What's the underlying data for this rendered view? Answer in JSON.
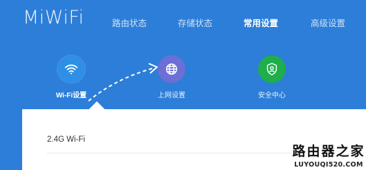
{
  "header": {
    "logo": "MiWiFi",
    "nav": [
      {
        "label": "路由状态"
      },
      {
        "label": "存储状态"
      },
      {
        "label": "常用设置",
        "active": true
      },
      {
        "label": "高级设置"
      }
    ]
  },
  "features": [
    {
      "label": "Wi-Fi设置",
      "icon": "wifi-icon",
      "color": "#2d8fe6",
      "active": true
    },
    {
      "label": "上网设置",
      "icon": "globe-icon",
      "color": "#6b6fd6"
    },
    {
      "label": "安全中心",
      "icon": "shield-user-icon",
      "color": "#1fae4b"
    }
  ],
  "panel": {
    "title": "2.4G Wi-Fi"
  },
  "watermark": {
    "title": "路由器之家",
    "url": "LUYOUQI520.COM"
  },
  "colors": {
    "header_bg": "#2d7ed8",
    "panel_bg": "#ffffff"
  }
}
